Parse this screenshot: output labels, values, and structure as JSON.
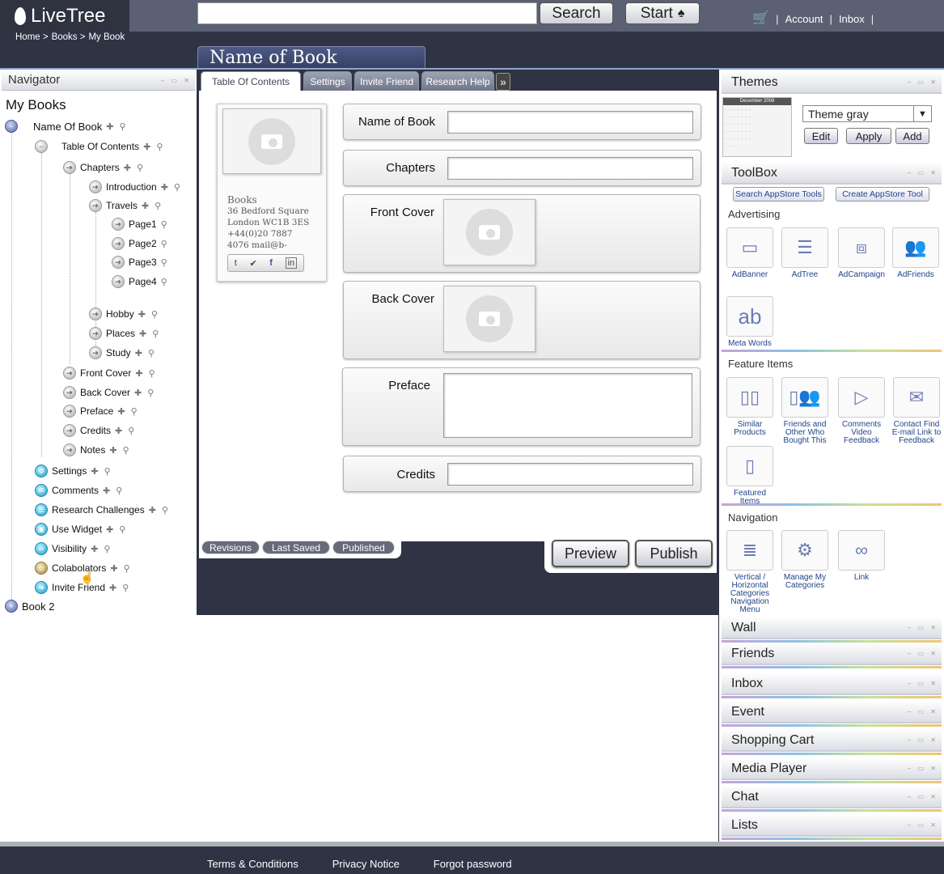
{
  "app": {
    "logo_text": "LiveTree"
  },
  "header": {
    "search_placeholder": "",
    "search_button": "Search",
    "start_button": "Start",
    "links": {
      "account": "Account",
      "inbox": "Inbox",
      "sep": "|"
    }
  },
  "breadcrumb": [
    "Home >",
    "Books >",
    "My Book"
  ],
  "page_title": "Name of Book",
  "navigator": {
    "title": "Navigator",
    "section": "My Books",
    "tree": {
      "name_of_book": "Name Of Book",
      "toc": "Table Of Contents",
      "chapters": "Chapters",
      "introduction": "Introduction",
      "travels": "Travels",
      "page1": "Page1",
      "page2": "Page2",
      "page3": "Page3",
      "page4": "Page4",
      "hobby": "Hobby",
      "places": "Places",
      "study": "Study",
      "front_cover": "Front Cover",
      "back_cover": "Back Cover",
      "preface": "Preface",
      "credits": "Credits",
      "notes": "Notes",
      "settings": "Settings",
      "comments": "Comments",
      "research": "Research Challenges",
      "use_widget": "Use Widget",
      "visibility": "Visibility",
      "colaborators": "Colabolators",
      "invite_friend": "Invite Friend",
      "book2": "Book 2"
    }
  },
  "tabs": [
    "Table Of Contents",
    "Settings",
    "Invite Friend",
    "Research Help"
  ],
  "tab_more": "»",
  "card": {
    "name": "Books",
    "address1": "36 Bedford Square",
    "address2": "London WC1B 3ES",
    "phone": "+44(0)20 7887",
    "mail": "4076 mail@b-"
  },
  "form": {
    "name_of_book": "Name of Book",
    "chapters": "Chapters",
    "front_cover": "Front Cover",
    "back_cover": "Back Cover",
    "preface": "Preface",
    "credits": "Credits"
  },
  "status_pills": [
    "Revisions",
    "Last Saved",
    "Published"
  ],
  "actions": {
    "preview": "Preview",
    "publish": "Publish"
  },
  "themes": {
    "title": "Themes",
    "calendar_month": "December 2008",
    "selected_theme": "Theme gray",
    "edit": "Edit",
    "apply": "Apply",
    "add": "Add"
  },
  "toolbox": {
    "title": "ToolBox",
    "search_tools": "Search AppStore Tools",
    "create_tool": "Create AppStore Tool",
    "advertising": "Advertising",
    "ad_tools": [
      "AdBanner",
      "AdTree",
      "AdCampaign",
      "AdFriends",
      "Meta Words"
    ],
    "feature_items": "Feature Items",
    "feature_tools": [
      "Similar Products",
      "Friends and Other Who Bought This",
      "Comments Video Feedback",
      "Contact Find E-mail Link to Feedback",
      "Featured Items"
    ],
    "navigation": "Navigation",
    "nav_tools": [
      "Vertical / Horizontal Categories Navigation Menu",
      "Manage My Categories",
      "Link"
    ]
  },
  "widgets": [
    "Wall",
    "Friends",
    "Inbox",
    "Event",
    "Shopping Cart",
    "Media Player",
    "Chat",
    "Lists"
  ],
  "footer": {
    "terms": "Terms & Conditions",
    "privacy": "Privacy Notice",
    "forgot": "Forgot password"
  }
}
